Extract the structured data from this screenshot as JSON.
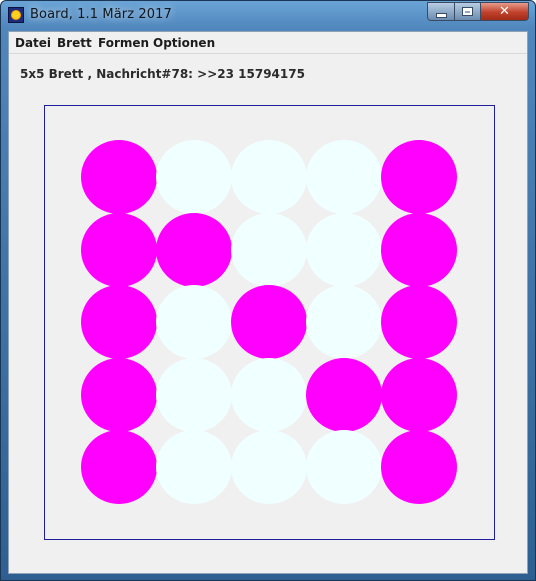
{
  "window": {
    "title": "Board, 1.1 März 2017"
  },
  "menu": {
    "items": [
      "Datei",
      "Brett",
      "Formen",
      "Optionen"
    ]
  },
  "status": {
    "text": "5x5 Brett , Nachricht#78: >>23 15794175"
  },
  "colors": {
    "on": "#ff00ff",
    "off": "#f0ffff",
    "frame": "#1f1f9e",
    "background": "#f0f0f0"
  },
  "board": {
    "rows": [
      [
        1,
        0,
        0,
        0,
        1
      ],
      [
        1,
        1,
        0,
        0,
        1
      ],
      [
        1,
        0,
        1,
        0,
        1
      ],
      [
        1,
        0,
        0,
        1,
        1
      ],
      [
        1,
        0,
        0,
        0,
        1
      ]
    ]
  }
}
